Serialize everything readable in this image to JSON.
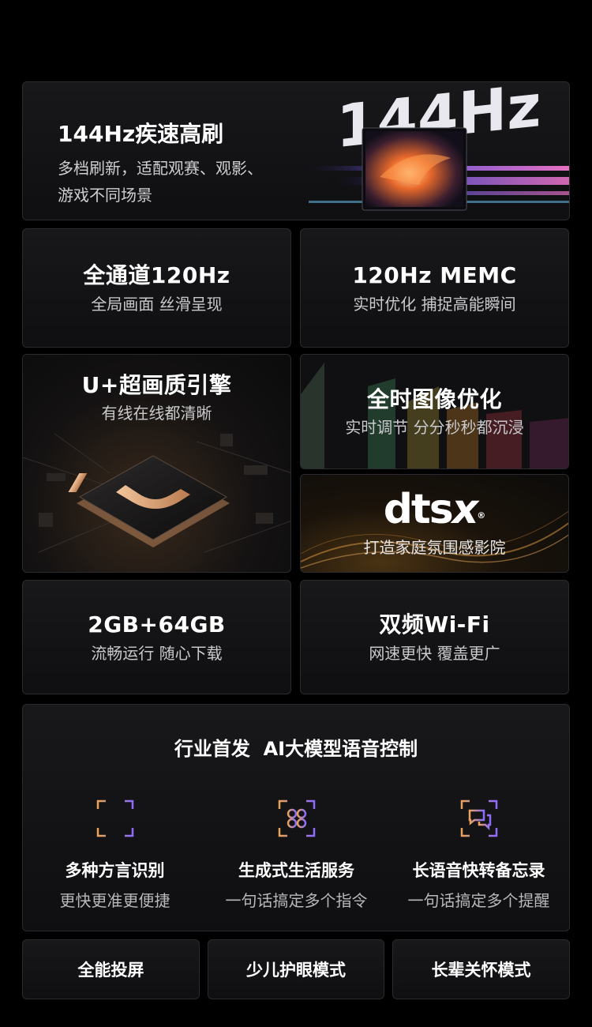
{
  "hero": {
    "title": "144Hz疾速高刷",
    "desc_line1": "多档刷新，适配观赛、观影、",
    "desc_line2": "游戏不同场景",
    "art_text": "144Hz"
  },
  "cards": {
    "ch120": {
      "title": "全通道120Hz",
      "sub": "全局画面 丝滑呈现"
    },
    "memc": {
      "title": "120Hz MEMC",
      "sub": "实时优化 捕捉高能瞬间"
    },
    "engine": {
      "title": "U+超画质引擎",
      "sub": "有线在线都清晰"
    },
    "imgopt": {
      "title": "全时图像优化",
      "sub": "实时调节 分分秒秒都沉浸"
    },
    "dts": {
      "logo": "dts",
      "logo_x": "x",
      "reg": "®",
      "sub": "打造家庭氛围感影院"
    },
    "storage": {
      "title": "2GB+64GB",
      "sub": "流畅运行 随心下载"
    },
    "wifi": {
      "title": "双频Wi-Fi",
      "sub": "网速更快 覆盖更广"
    }
  },
  "ai": {
    "heading": "行业首发  AI大模型语音控制",
    "features": [
      {
        "icon": "voice-wave-icon",
        "title": "多种方言识别",
        "sub": "更快更准更便捷"
      },
      {
        "icon": "service-grid-icon",
        "title": "生成式生活服务",
        "sub": "一句话搞定多个指令"
      },
      {
        "icon": "chat-bubble-icon",
        "title": "长语音快转备忘录",
        "sub": "一句话搞定多个提醒"
      }
    ]
  },
  "bottom": [
    "全能投屏",
    "少儿护眼模式",
    "长辈关怀模式"
  ],
  "colors": {
    "accent_orange": "#e9a35a",
    "accent_purple": "#8b6cff",
    "gold": "#c9935e"
  }
}
